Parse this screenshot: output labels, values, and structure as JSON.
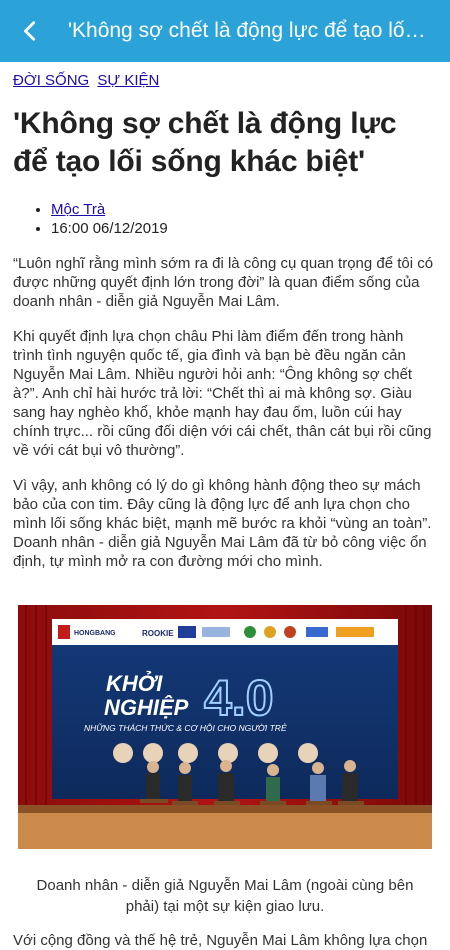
{
  "header": {
    "title": "'Không sợ chết là động lực để tạo lối sống khác biệt'"
  },
  "breadcrumb": [
    "ĐỜI SỐNG",
    "SỰ KIỆN"
  ],
  "article": {
    "headline": "'Không sợ chết là động lực để tạo lối sống khác biệt'",
    "author": "Mộc Trà",
    "datetime": "16:00 06/12/2019",
    "paragraphs": [
      "“Luôn nghĩ rằng mình sớm ra đi là công cụ quan trọng để tôi có được những quyết định lớn trong đời” là quan điểm sống của doanh nhân - diễn giả Nguyễn Mai Lâm.",
      "Khi quyết định lựa chọn châu Phi làm điểm đến trong hành trình tình nguyện quốc tế, gia đình và bạn bè đều ngăn cản Nguyễn Mai Lâm. Nhiều người hỏi anh: “Ông không sợ chết à?”. Anh chỉ hài hước trả lời: “Chết thì ai mà không sợ. Giàu sang hay nghèo khổ, khỏe mạnh hay đau ốm, luồn cúi hay chính trực... rồi cũng đối diện với cái chết, thân cát bụi rồi cũng về với cát bụi vô thường”.",
      "Vì vậy, anh không có lý do gì không hành động theo sự mách bảo của con tim. Đây cũng là động lực để anh lựa chọn cho mình lối sống khác biệt, mạnh mẽ bước ra khỏi “vùng an toàn”. Doanh nhân - diễn giả Nguyễn Mai Lâm đã từ bỏ công việc ổn định, tự mình mở ra con đường mới cho mình."
    ],
    "image": {
      "banner_line1": "KHỞI",
      "banner_line2": "NGHIỆP",
      "banner_number": "4.0",
      "banner_subtitle": "NHỮNG THÁCH THỨC & CƠ HỘI CHO NGƯỜI TRẺ",
      "sponsor_left": "HONGBANG",
      "sponsor_rookie": "ROOKIE"
    },
    "caption": "Doanh nhân - diễn giả Nguyễn Mai Lâm (ngoài cùng bên phải) tại một sự kiện giao lưu.",
    "last_paragraph": "Với cộng đồng và thế hệ trẻ, Nguyễn Mai Lâm không lựa chọn"
  }
}
